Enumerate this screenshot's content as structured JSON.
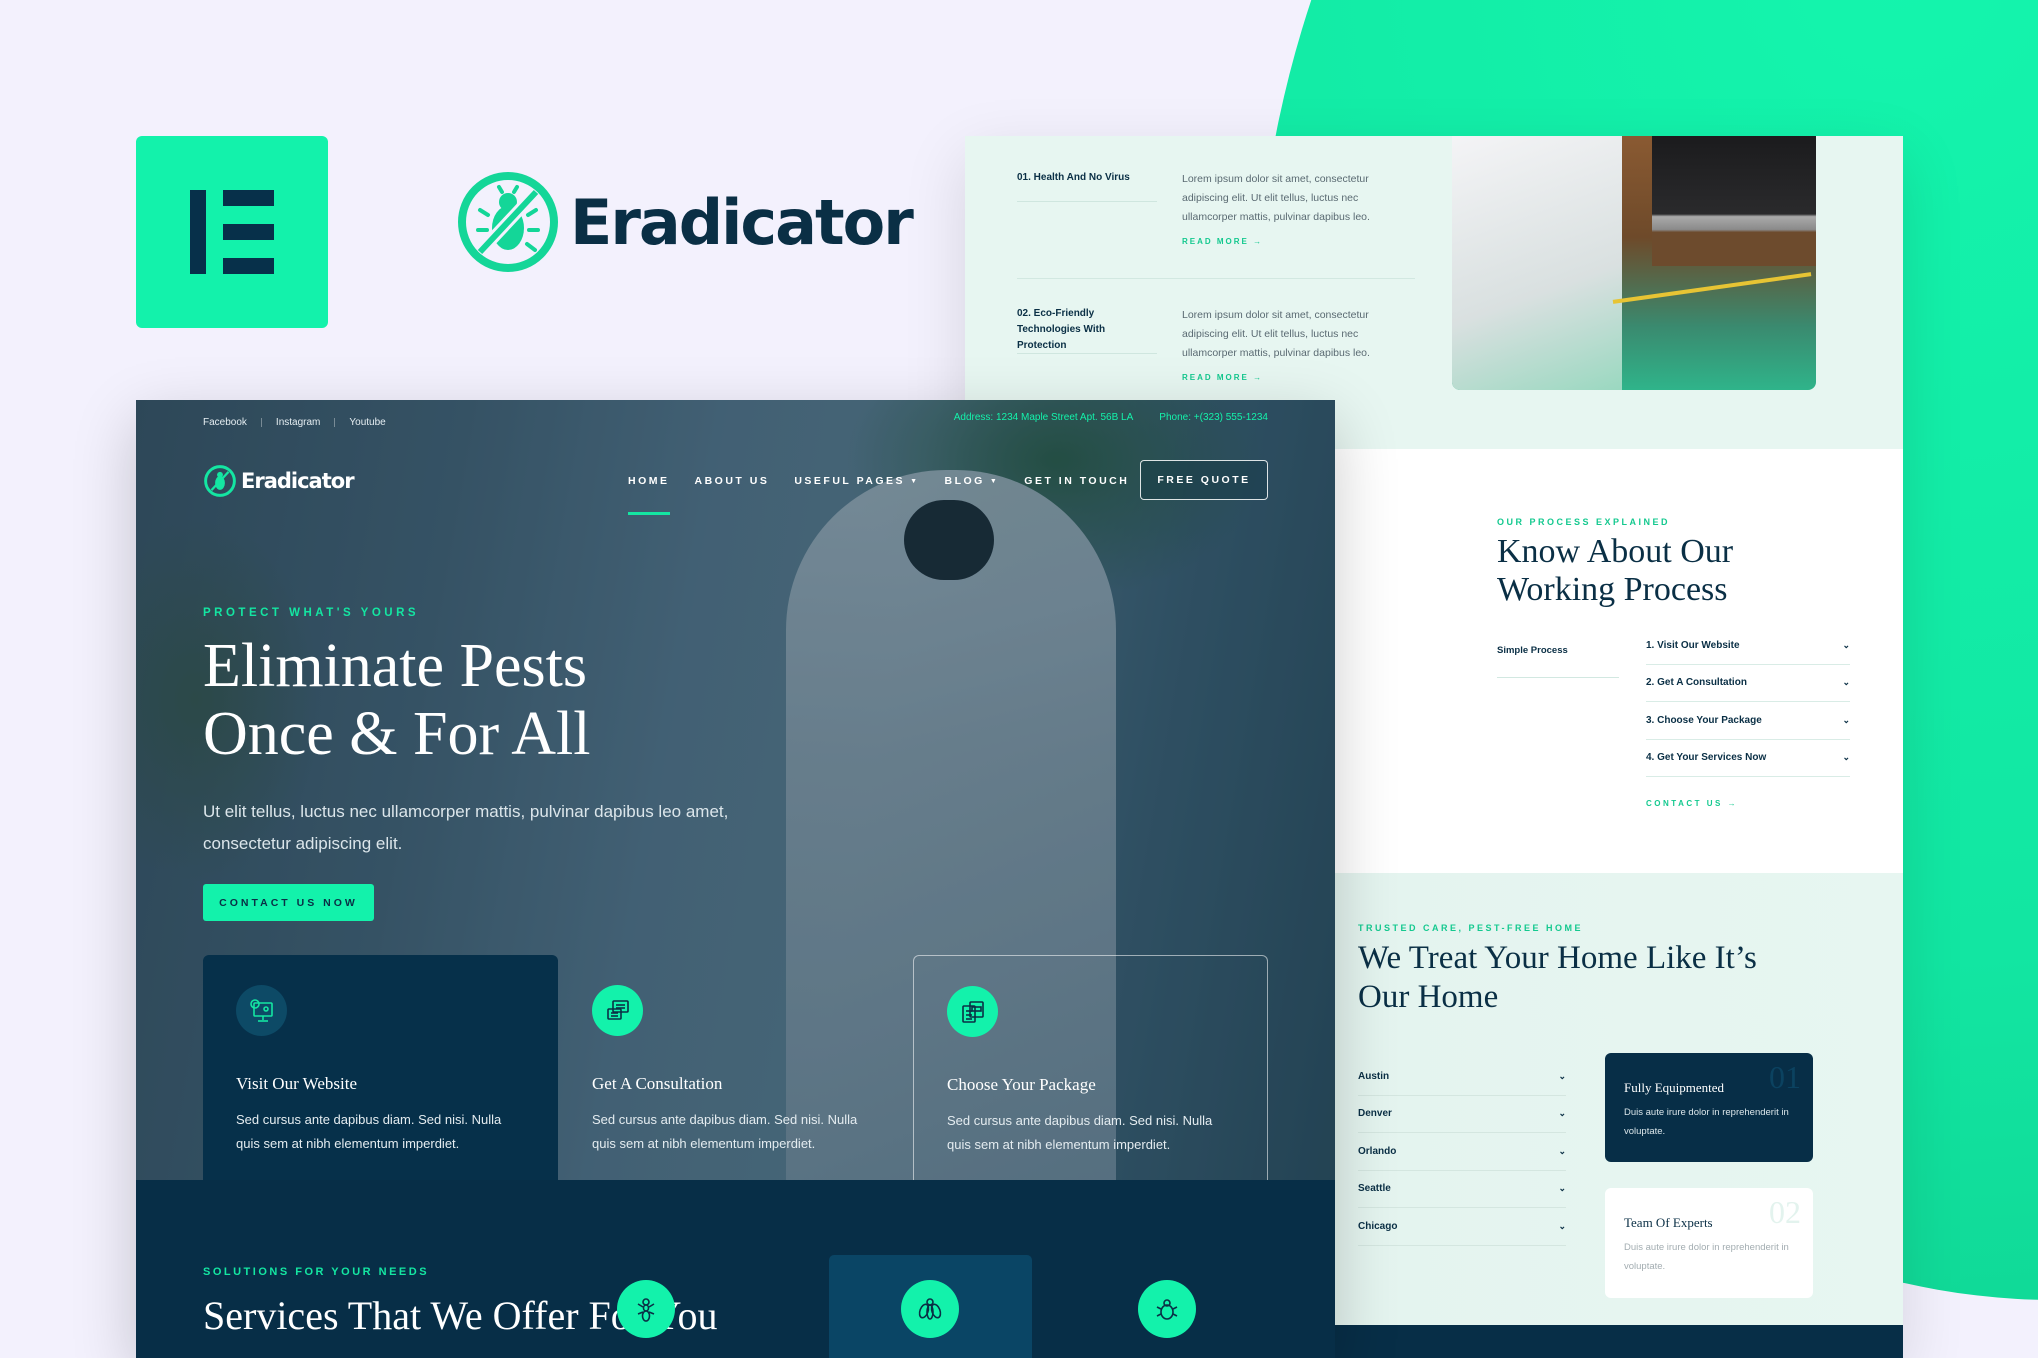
{
  "brand": {
    "builder_logo": "elementor-icon",
    "name": "Eradicator",
    "logo_icon": "no-bug-icon",
    "accent_color": "#13f2ab",
    "dark_color": "#072e47"
  },
  "main_mockup": {
    "topbar": {
      "social": [
        "Facebook",
        "Instagram",
        "Youtube"
      ],
      "address": "Address: 1234 Maple Street Apt. 56B LA",
      "phone": "Phone: +(323) 555-1234"
    },
    "nav": {
      "logo_text": "Eradicator",
      "items": [
        {
          "label": "HOME",
          "active": true,
          "dropdown": false
        },
        {
          "label": "ABOUT US",
          "active": false,
          "dropdown": false
        },
        {
          "label": "USEFUL PAGES",
          "active": false,
          "dropdown": true
        },
        {
          "label": "BLOG",
          "active": false,
          "dropdown": true
        },
        {
          "label": "GET IN TOUCH",
          "active": false,
          "dropdown": false
        }
      ],
      "cta": "FREE QUOTE"
    },
    "hero": {
      "eyebrow": "PROTECT WHAT'S YOURS",
      "title_line1": "Eliminate Pests",
      "title_line2": "Once & For All",
      "subtitle": "Ut elit tellus, luctus nec ullamcorper mattis, pulvinar dapibus leo amet, consectetur adipiscing elit.",
      "cta": "CONTACT US NOW"
    },
    "steps": [
      {
        "icon": "monitor-users-icon",
        "title": "Visit Our Website",
        "desc": "Sed cursus ante dapibus diam. Sed nisi. Nulla quis sem at nibh elementum imperdiet."
      },
      {
        "icon": "chat-bubbles-icon",
        "title": "Get A Consultation",
        "desc": "Sed cursus ante dapibus diam. Sed nisi. Nulla quis sem at nibh elementum imperdiet."
      },
      {
        "icon": "package-documents-icon",
        "title": "Choose Your Package",
        "desc": "Sed cursus ante dapibus diam. Sed nisi. Nulla quis sem at nibh elementum imperdiet."
      }
    ],
    "services": {
      "eyebrow": "SOLUTIONS FOR YOUR NEEDS",
      "title": "Services That We Offer For You",
      "icons": [
        "ant-icon",
        "fly-icon",
        "bug-icon"
      ]
    }
  },
  "right_mockup": {
    "features": [
      {
        "title": "01. Health And No Virus",
        "desc": "Lorem ipsum dolor sit amet, consectetur adipiscing elit. Ut elit tellus, luctus nec ullamcorper mattis, pulvinar dapibus leo.",
        "link": "READ MORE →"
      },
      {
        "title": "02. Eco-Friendly Technologies With Protection",
        "desc": "Lorem ipsum dolor sit amet, consectetur adipiscing elit. Ut elit tellus, luctus nec ullamcorper mattis, pulvinar dapibus leo.",
        "link": "READ MORE →"
      }
    ],
    "process": {
      "eyebrow": "OUR PROCESS EXPLAINED",
      "title_line1": "Know About Our",
      "title_line2": "Working Process",
      "tab": "Simple Process",
      "steps": [
        "1. Visit Our Website",
        "2. Get A Consultation",
        "3. Choose Your Package",
        "4. Get Your Services Now"
      ],
      "link": "CONTACT US →"
    },
    "home": {
      "eyebrow": "TRUSTED CARE, PEST-FREE HOME",
      "title_line1": "We Treat Your Home Like It’s",
      "title_line2": "Our Home",
      "cities": [
        "Austin",
        "Denver",
        "Orlando",
        "Seattle",
        "Chicago"
      ],
      "cards": [
        {
          "num": "01",
          "title": "Fully Equipmented",
          "desc": "Duis aute irure dolor in reprehenderit in voluptate."
        },
        {
          "num": "02",
          "title": "Team Of Experts",
          "desc": "Duis aute irure dolor in reprehenderit in voluptate."
        }
      ]
    }
  }
}
